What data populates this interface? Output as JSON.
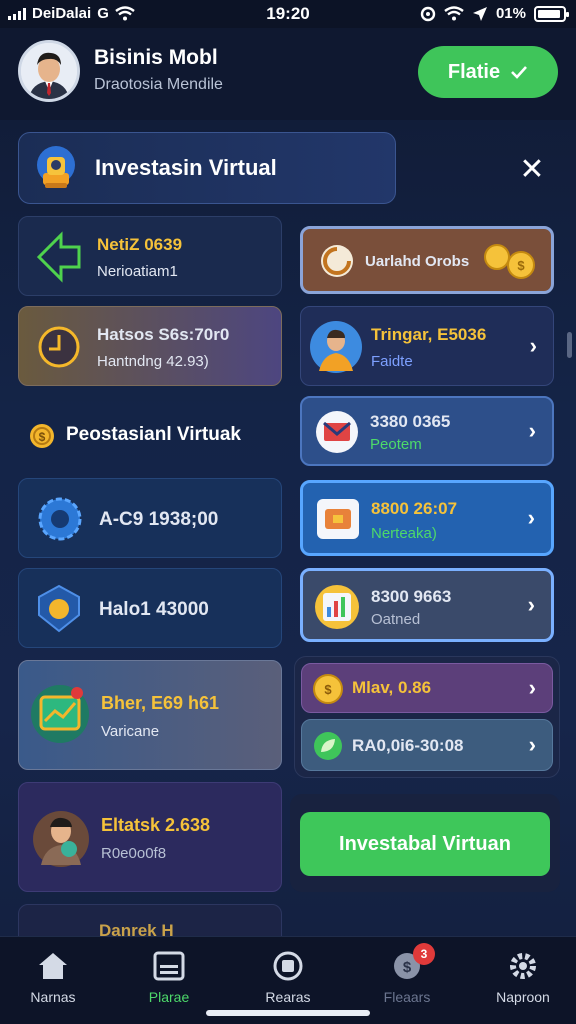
{
  "status_bar": {
    "carrier": "DeiDalai",
    "carrier_icon_text": "G",
    "time": "19:20",
    "battery": "01%"
  },
  "header": {
    "title": "Bisinis Mobl",
    "subtitle": "Draotosia Mendile",
    "button_label": "Flatie"
  },
  "banner": {
    "label": "Investasin Virtual"
  },
  "left_cards": [
    {
      "title": "NetiZ 0639",
      "subtitle": "Nerioatiam1"
    },
    {
      "title": "Hatsos S6s:70r0",
      "subtitle": "Hantndng 42.93)"
    },
    {
      "title": "Peostasianl Virtuak"
    },
    {
      "title": "A-C9 1938;00"
    },
    {
      "title": "Halo1 43000"
    },
    {
      "title": "Bher, E69 h61",
      "subtitle": "Varicane"
    },
    {
      "title": "Eltatsk 2.638",
      "subtitle": "R0e0o0f8"
    },
    {
      "title": "Danrek H"
    }
  ],
  "right_cards": [
    {
      "title": "Uarlahd Orobs"
    },
    {
      "title": "Tringar, E5036",
      "subtitle": "Faidte"
    },
    {
      "title": "3380 0365",
      "subtitle": "Peotem"
    },
    {
      "title": "8800 26:07",
      "subtitle": "Nerteaka)"
    },
    {
      "title": "8300 9663",
      "subtitle": "Oatned"
    },
    {
      "title": "Mlav, 0.86"
    },
    {
      "title": "RA0,0i6-30:08"
    }
  ],
  "cta": {
    "label": "Investabal Virtuan"
  },
  "nav": [
    {
      "label": "Narnas"
    },
    {
      "label": "Plarae"
    },
    {
      "label": "Rearas"
    },
    {
      "label": "Fleaars",
      "badge": "3"
    },
    {
      "label": "Naproon"
    }
  ],
  "colors": {
    "accent_green": "#3fc55a",
    "accent_yellow": "#f5c23a",
    "background": "#142447"
  }
}
